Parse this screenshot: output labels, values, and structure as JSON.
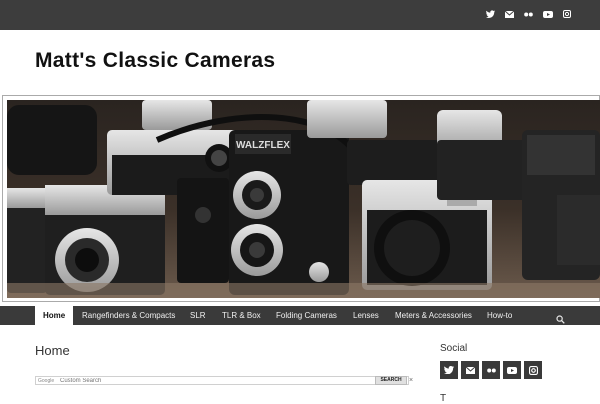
{
  "site": {
    "title": "Matt's Classic Cameras"
  },
  "topbar": {
    "social_icons": [
      "twitter-icon",
      "mail-icon",
      "flickr-icon",
      "youtube-icon",
      "instagram-icon"
    ]
  },
  "banner": {
    "camera_label": "WALZFLEX"
  },
  "nav": {
    "items": [
      {
        "label": "Home",
        "active": true
      },
      {
        "label": "Rangefinders & Compacts"
      },
      {
        "label": "SLR"
      },
      {
        "label": "TLR & Box"
      },
      {
        "label": "Folding Cameras"
      },
      {
        "label": "Lenses"
      },
      {
        "label": "Meters & Accessories"
      },
      {
        "label": "How-to"
      }
    ],
    "search_icon": "search-icon"
  },
  "main": {
    "heading": "Home",
    "search": {
      "brand": "Google",
      "placeholder": "Custom Search",
      "button": "SEARCH",
      "clear": "×"
    }
  },
  "sidebar": {
    "social_title": "Social",
    "social_icons": [
      "twitter-icon",
      "mail-icon",
      "flickr-icon",
      "youtube-icon",
      "instagram-icon"
    ],
    "next_heading_fragment": "T"
  },
  "colors": {
    "topbar": "#3d3d3d",
    "nav": "#3a3a3a",
    "icon_bg": "#3a3a3a"
  }
}
